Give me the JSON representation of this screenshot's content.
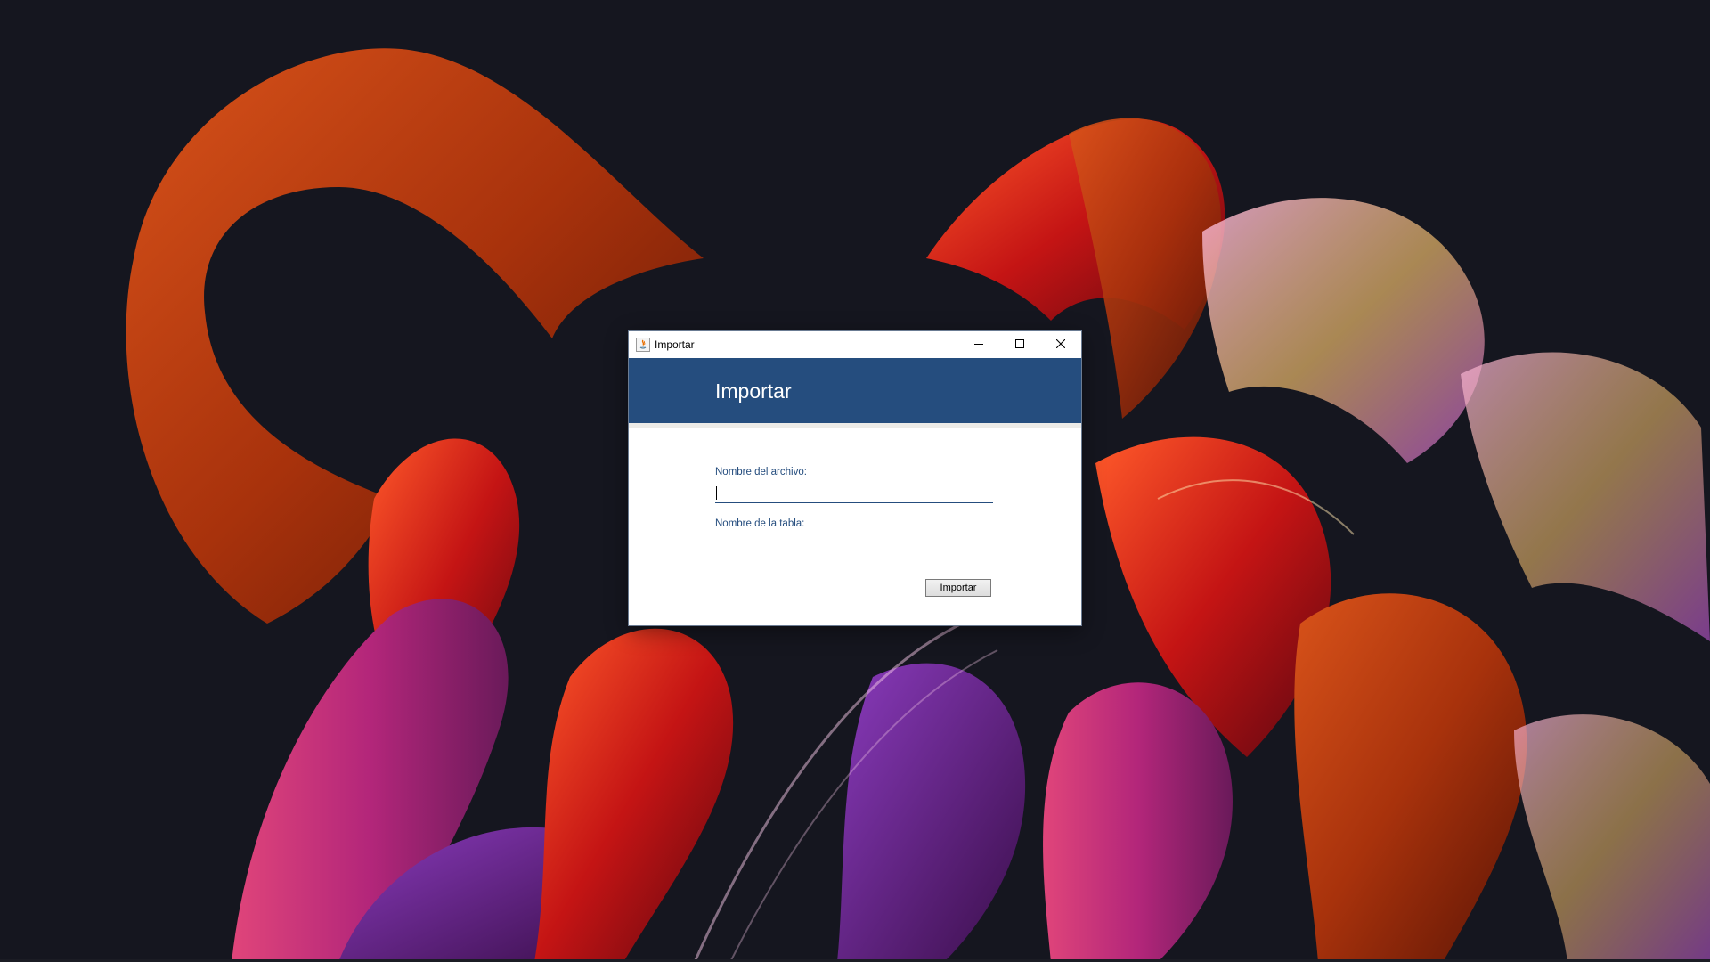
{
  "window": {
    "title": "Importar",
    "controls": {
      "minimize_icon": "minimize-icon",
      "maximize_icon": "maximize-icon",
      "close_icon": "close-icon"
    }
  },
  "header": {
    "title": "Importar"
  },
  "form": {
    "archivo_label": "Nombre del archivo:",
    "archivo_value": "",
    "tabla_label": "Nombre de la tabla:",
    "tabla_value": "",
    "import_button_label": "Importar"
  },
  "colors": {
    "header_blue": "#254d7e",
    "window_bg": "#ffffff",
    "desktop_bg": "#15161f",
    "wallpaper_orange": "#c2410c",
    "wallpaper_red": "#b91c1c",
    "wallpaper_pink": "#db2777",
    "wallpaper_purple": "#7e22ce"
  }
}
